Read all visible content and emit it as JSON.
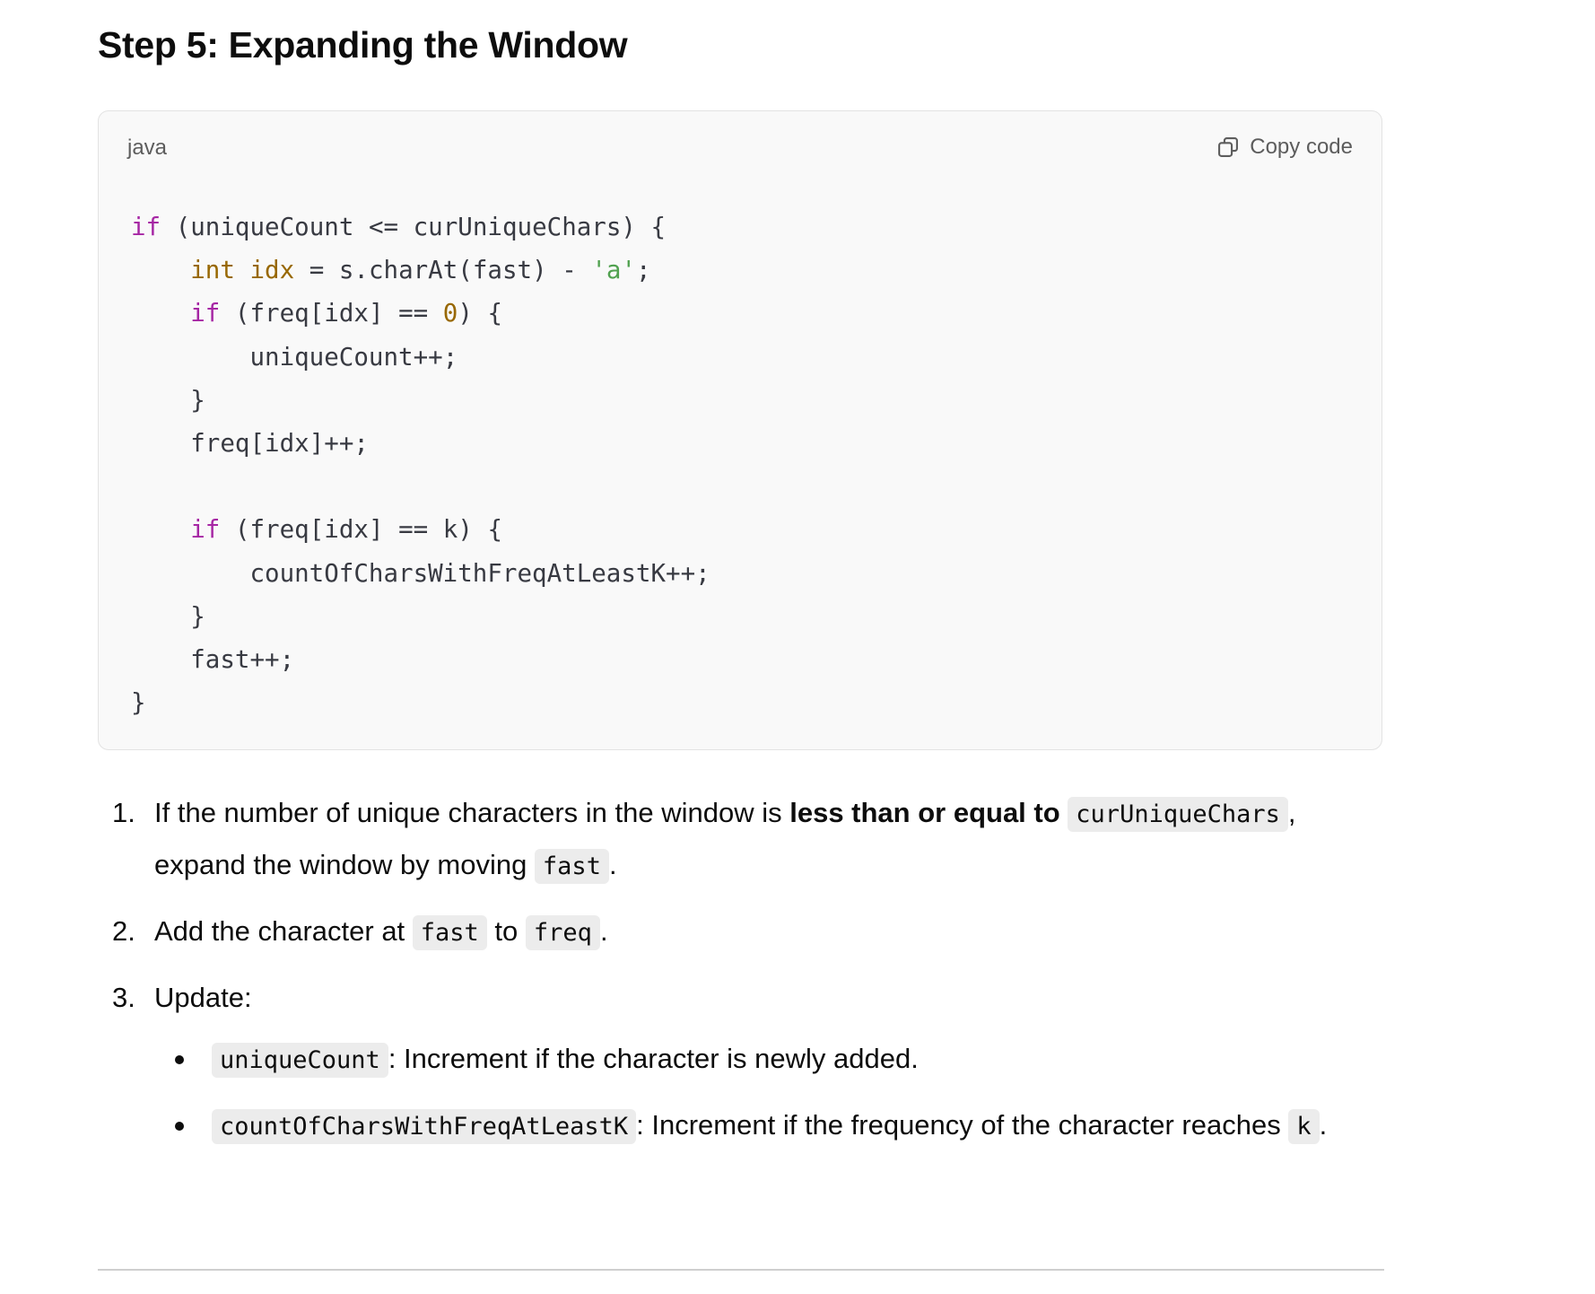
{
  "heading": "Step 5: Expanding the Window",
  "code_block": {
    "language": "java",
    "copy_label": "Copy code",
    "copy_icon": "copy-icon",
    "colors": {
      "keyword": "#a626a4",
      "type": "#986801",
      "number": "#986801",
      "string": "#50a14f",
      "text": "#383a42"
    },
    "lines": [
      "if (uniqueCount <= curUniqueChars) {",
      "    int idx = s.charAt(fast) - 'a';",
      "    if (freq[idx] == 0) {",
      "        uniqueCount++;",
      "    }",
      "    freq[idx]++;",
      "",
      "    if (freq[idx] == k) {",
      "        countOfCharsWithFreqAtLeastK++;",
      "    }",
      "    fast++;",
      "}"
    ]
  },
  "steps": [
    {
      "marker": "1.",
      "parts": [
        {
          "type": "text",
          "text": "If the number of unique characters in the window is "
        },
        {
          "type": "bold",
          "text": "less than or equal to"
        },
        {
          "type": "text",
          "text": " "
        },
        {
          "type": "code",
          "text": "curUniqueChars"
        },
        {
          "type": "text",
          "text": ", expand the window by moving "
        },
        {
          "type": "code",
          "text": "fast"
        },
        {
          "type": "text",
          "text": "."
        }
      ]
    },
    {
      "marker": "2.",
      "parts": [
        {
          "type": "text",
          "text": "Add the character at "
        },
        {
          "type": "code",
          "text": "fast"
        },
        {
          "type": "text",
          "text": " to "
        },
        {
          "type": "code",
          "text": "freq"
        },
        {
          "type": "text",
          "text": "."
        }
      ]
    },
    {
      "marker": "3.",
      "parts": [
        {
          "type": "text",
          "text": "Update:"
        }
      ],
      "bullets": [
        [
          {
            "type": "code",
            "text": "uniqueCount"
          },
          {
            "type": "text",
            "text": ": Increment if the character is newly added."
          }
        ],
        [
          {
            "type": "code",
            "text": "countOfCharsWithFreqAtLeastK"
          },
          {
            "type": "text",
            "text": ": Increment if the frequency of the character reaches "
          },
          {
            "type": "code",
            "text": "k"
          },
          {
            "type": "text",
            "text": "."
          }
        ]
      ]
    }
  ]
}
